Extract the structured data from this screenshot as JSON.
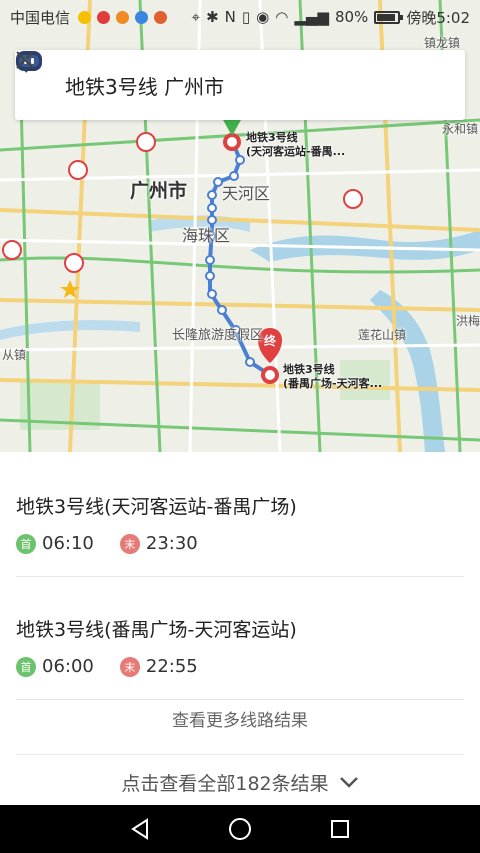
{
  "status_bar": {
    "carrier": "中国电信",
    "battery": "80%",
    "battery_level": 0.8,
    "time": "傍晚5:02"
  },
  "search": {
    "title": "地铁3号线 广州市"
  },
  "map": {
    "labels": {
      "city": "广州市",
      "tianhe": "天河区",
      "haizhu": "海珠区",
      "changlong": "长隆旅游度假区",
      "lianhuashan": "莲花山镇",
      "congzhen": "从镇",
      "yonghe": "永和镇",
      "zhenkou": "镇龙镇",
      "hongmei": "洪梅"
    },
    "start_label_line1": "地铁3号线",
    "start_label_line2": "(天河客运站-番禺...",
    "end_label_line1": "地铁3号线",
    "end_label_line2": "(番禺广场-天河客...",
    "end_marker_text": "终",
    "route_color": "#4a7fd1",
    "start_color": "#e04040",
    "end_color": "#e04040"
  },
  "routes": [
    {
      "title": "地铁3号线(天河客运站-番禺广场)",
      "first_badge": "首",
      "first_time": "06:10",
      "last_badge": "末",
      "last_time": "23:30"
    },
    {
      "title": "地铁3号线(番禺广场-天河客运站)",
      "first_badge": "首",
      "first_time": "06:00",
      "last_badge": "末",
      "last_time": "22:55"
    }
  ],
  "more_link": "查看更多线路结果",
  "all_results": "点击查看全部182条结果"
}
